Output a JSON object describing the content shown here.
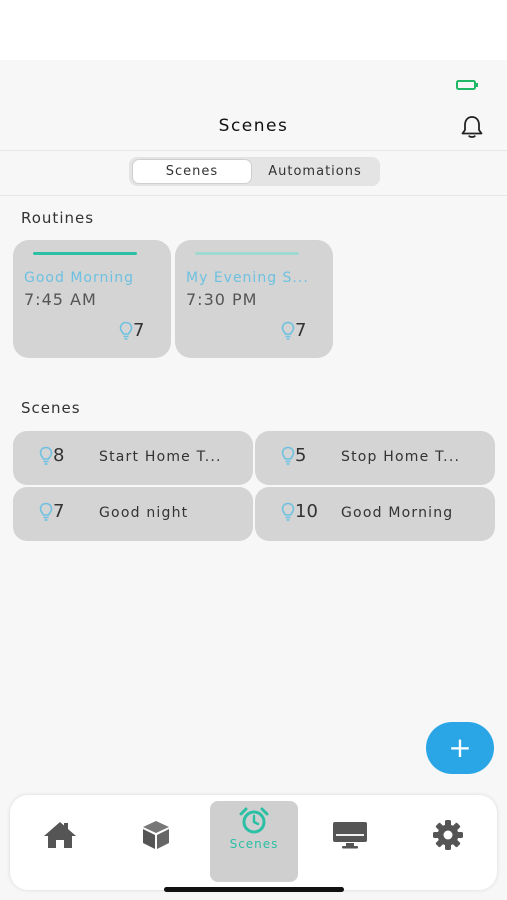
{
  "header": {
    "title": "Scenes"
  },
  "segment": {
    "active": "Scenes",
    "inactive": "Automations"
  },
  "routines": {
    "title": "Routines",
    "items": [
      {
        "name": "Good Morning",
        "time": "7:45 AM",
        "count": "7"
      },
      {
        "name": "My Evening S...",
        "time": "7:30 PM",
        "count": "7"
      }
    ]
  },
  "scenes": {
    "title": "Scenes",
    "items": [
      {
        "name": "Start Home T...",
        "count": "8"
      },
      {
        "name": "Stop Home T...",
        "count": "5"
      },
      {
        "name": "Good night",
        "count": "7"
      },
      {
        "name": "Good Morning",
        "count": "10"
      }
    ]
  },
  "tabbar": {
    "active_label": "Scenes",
    "icons": [
      "home-icon",
      "cube-icon",
      "alarm-clock-icon",
      "monitor-icon",
      "gear-icon"
    ]
  },
  "fab": {
    "label": "+"
  },
  "colors": {
    "accent": "#2aa6e6",
    "routine_bar_1": "#2bbfa5",
    "routine_bar_2": "#9fd9cf",
    "card": "#d4d4d4",
    "bulb": "#6ec1e0",
    "active_tab_icon": "#2bbfa5"
  }
}
